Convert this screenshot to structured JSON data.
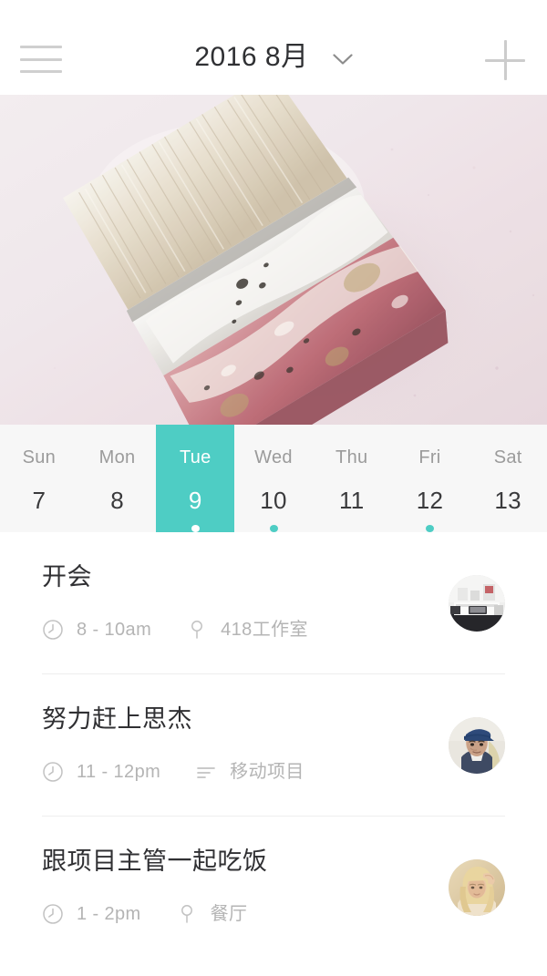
{
  "app": {
    "accent_color": "#4ECDC4",
    "background": "#FFFFFF",
    "strip_background": "#F7F7F7"
  },
  "header": {
    "menu_icon": "hamburger-icon",
    "title": "2016 8月",
    "dropdown_icon": "chevron-down-icon",
    "add_icon": "plus-icon"
  },
  "hero": {
    "alt": "paintbrush-photo",
    "description": "Used paint brush with white and pink paint against soft pink textured wall"
  },
  "week": {
    "days": [
      {
        "name": "Sun",
        "number": "7",
        "selected": false,
        "has_event": false
      },
      {
        "name": "Mon",
        "number": "8",
        "selected": false,
        "has_event": false
      },
      {
        "name": "Tue",
        "number": "9",
        "selected": true,
        "has_event": true
      },
      {
        "name": "Wed",
        "number": "10",
        "selected": false,
        "has_event": true
      },
      {
        "name": "Thu",
        "number": "11",
        "selected": false,
        "has_event": false
      },
      {
        "name": "Fri",
        "number": "12",
        "selected": false,
        "has_event": true
      },
      {
        "name": "Sat",
        "number": "13",
        "selected": false,
        "has_event": false
      }
    ]
  },
  "events": [
    {
      "title": "开会",
      "time_icon": "clock-icon",
      "time": "8 - 10am",
      "detail_icon": "location-pin-icon",
      "detail": "418工作室",
      "avatar": "workspace-desk-avatar"
    },
    {
      "title": "努力赶上思杰",
      "time_icon": "clock-icon",
      "time": "11 - 12pm",
      "detail_icon": "list-lines-icon",
      "detail": "移动项目",
      "avatar": "man-with-cap-avatar"
    },
    {
      "title": "跟项目主管一起吃饭",
      "time_icon": "clock-icon",
      "time": "1 - 2pm",
      "detail_icon": "location-pin-icon",
      "detail": "餐厅",
      "avatar": "blonde-woman-avatar"
    }
  ]
}
